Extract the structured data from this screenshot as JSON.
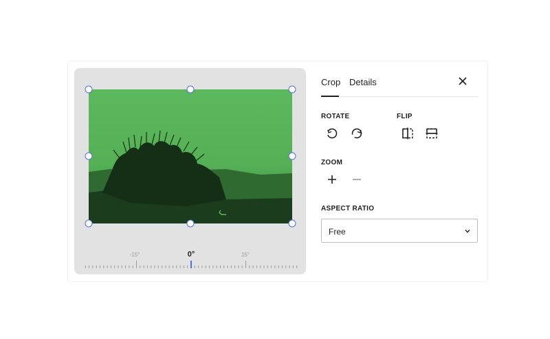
{
  "tabs": [
    {
      "label": "Crop",
      "active": true
    },
    {
      "label": "Details",
      "active": false
    }
  ],
  "close_icon": "close-icon",
  "sections": {
    "rotate": {
      "label": "ROTATE",
      "icons": [
        "rotate-left-icon",
        "rotate-right-icon"
      ]
    },
    "flip": {
      "label": "FLIP",
      "icons": [
        "flip-horizontal-icon",
        "flip-vertical-icon"
      ]
    },
    "zoom": {
      "label": "ZOOM",
      "icons": [
        "zoom-in-icon",
        "zoom-out-icon"
      ]
    },
    "aspect_ratio": {
      "label": "ASPECT RATIO",
      "value": "Free"
    }
  },
  "ruler": {
    "labels": [
      "-15°",
      "0°",
      "15°"
    ],
    "current_angle": 0
  },
  "colors": {
    "accent": "#4f6ee0",
    "image_tint": "#55b056"
  }
}
